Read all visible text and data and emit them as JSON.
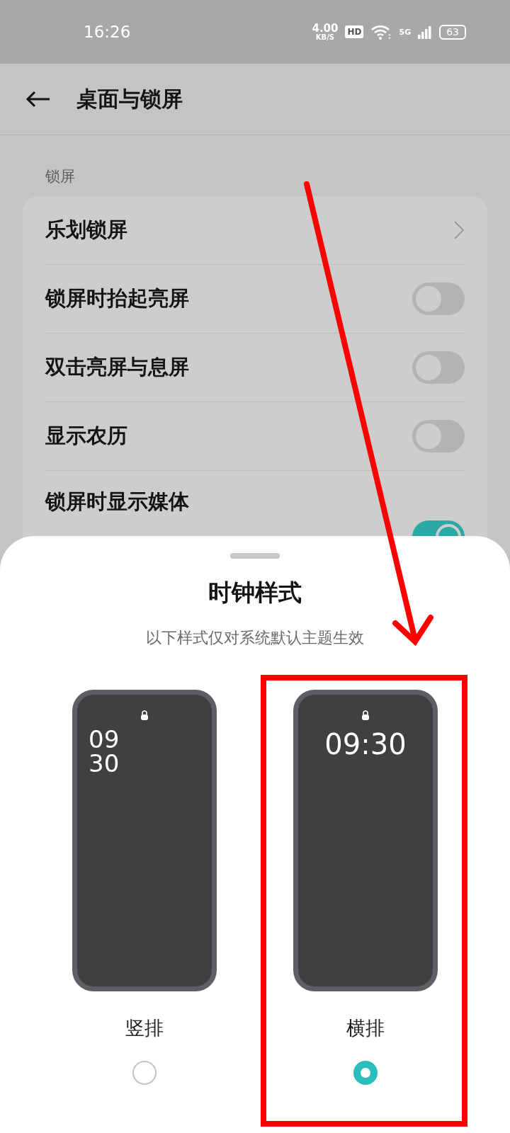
{
  "status_bar": {
    "time": "16:26",
    "net_speed": "4.00",
    "net_unit": "KB/S",
    "hd": "HD",
    "network": "5G",
    "battery": "63"
  },
  "header": {
    "title": "桌面与锁屏"
  },
  "section": {
    "label": "锁屏"
  },
  "settings": [
    {
      "kind": "link",
      "title": "乐划锁屏"
    },
    {
      "kind": "toggle",
      "title": "锁屏时抬起亮屏",
      "on": false
    },
    {
      "kind": "toggle",
      "title": "双击亮屏与息屏",
      "on": false
    },
    {
      "kind": "toggle",
      "title": "显示农历",
      "on": false
    },
    {
      "kind": "toggle",
      "title": "锁屏时显示媒体",
      "on": true
    }
  ],
  "sheet": {
    "title": "时钟样式",
    "subtitle": "以下样式仅对系统默认主题生效",
    "options": [
      {
        "kind": "vertical",
        "clock_lines": [
          "09",
          "30"
        ],
        "label": "竖排",
        "selected": false
      },
      {
        "kind": "horizontal",
        "clock_lines": [
          "09:30"
        ],
        "label": "横排",
        "selected": true
      }
    ]
  }
}
